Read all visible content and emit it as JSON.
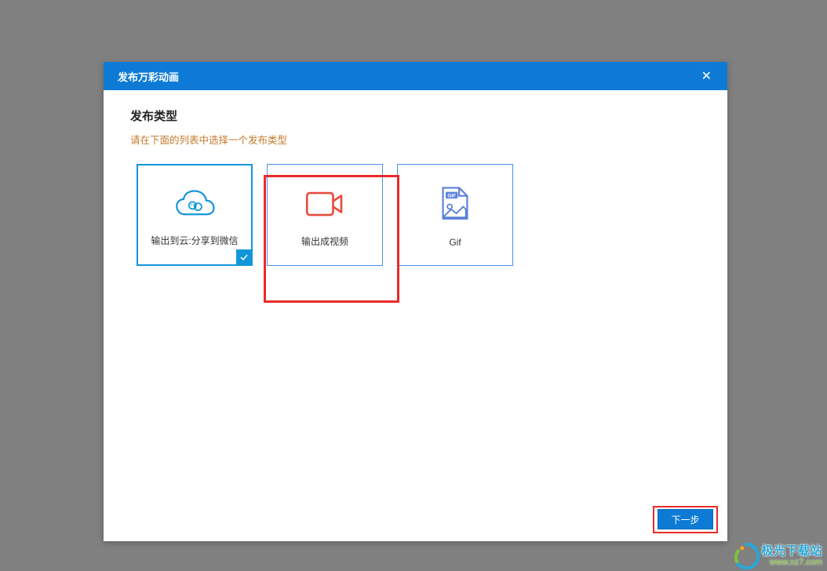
{
  "dialog": {
    "title": "发布万彩动画",
    "close": "✕"
  },
  "section": {
    "title": "发布类型",
    "hint": "请在下面的列表中选择一个发布类型"
  },
  "options": {
    "cloud": {
      "label": "输出到云:分享到微信"
    },
    "video": {
      "label": "输出成视频"
    },
    "gif": {
      "label": "Gif"
    }
  },
  "footer": {
    "next": "下一步"
  },
  "watermark": {
    "line1": "极光下载站",
    "line2": "www.xz7.com"
  }
}
